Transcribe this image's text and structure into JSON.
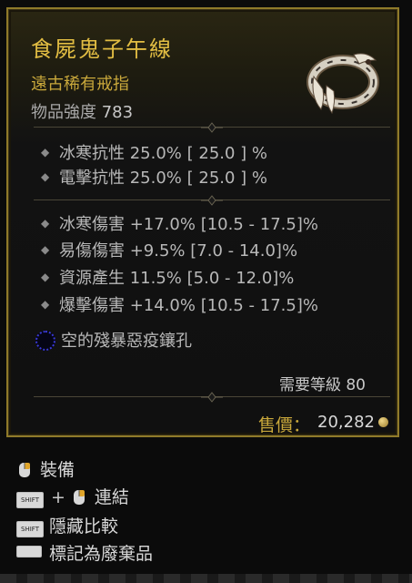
{
  "item": {
    "name": "食屍鬼子午線",
    "rarity_type": "遠古稀有戒指",
    "power_label": "物品強度",
    "power_value": "783",
    "base_stats": [
      "冰寒抗性 25.0%  [ 25.0 ] %",
      "電擊抗性 25.0%  [ 25.0 ] %"
    ],
    "affixes": [
      "冰寒傷害 +17.0% [10.5 - 17.5]%",
      "易傷傷害 +9.5% [7.0 - 14.0]%",
      "資源產生 11.5% [5.0 - 12.0]%",
      "爆擊傷害 +14.0% [10.5 - 17.5]%"
    ],
    "socket_text": "空的殘暴惡疫鑲孔",
    "required_level": "需要等級 80",
    "price_label": "售價：",
    "price_value": "20,282"
  },
  "actions": {
    "equip": "裝備",
    "link_plus": "+",
    "link": "連結",
    "hide_compare": "隱藏比較",
    "mark_junk": "標記為廢棄品",
    "shift_key": "SHIFT"
  },
  "icons": {
    "item": "ring-icon",
    "socket": "empty-socket-icon",
    "currency": "gold-coin-icon"
  },
  "colors": {
    "title": "#e2bd43",
    "rarity": "#c9a83b",
    "border": "#8f7a2a",
    "socket": "#3a3ad8"
  }
}
